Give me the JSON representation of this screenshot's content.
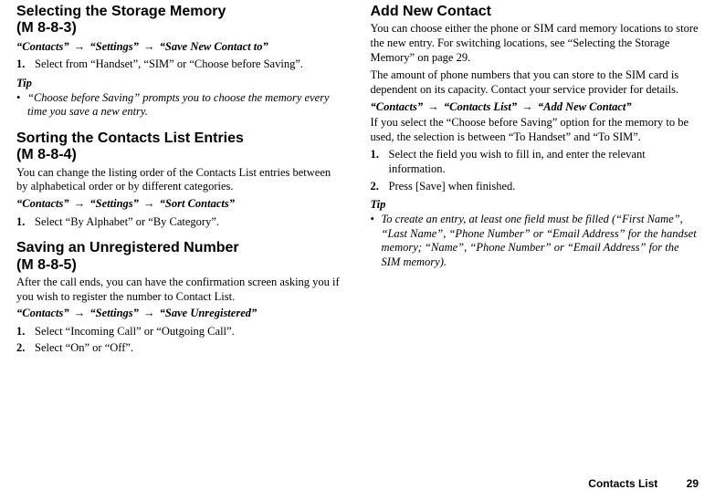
{
  "left": {
    "sec1": {
      "heading": "Selecting the Storage Memory",
      "mref": "(M 8-8-3)",
      "crumb1": "“Contacts”",
      "arrow": "→",
      "crumb2": "“Settings”",
      "crumb3": "“Save New Contact to”",
      "step1_num": "1.",
      "step1": "Select from “Handset”, “SIM” or “Choose before Saving”.",
      "tip_label": "Tip",
      "tip_bullet": "•",
      "tip_text": "“Choose before Saving” prompts you to choose the memory every time you save a new entry."
    },
    "sec2": {
      "heading": "Sorting the Contacts List Entries",
      "mref": "(M 8-8-4)",
      "body": "You can change the listing order of the Contacts List entries between by alphabetical order or by different categories.",
      "crumb1": "“Contacts”",
      "crumb2": "“Settings”",
      "crumb3": "“Sort Contacts”",
      "step1_num": "1.",
      "step1": "Select “By Alphabet” or “By Category”."
    },
    "sec3": {
      "heading": "Saving an Unregistered Number",
      "mref": "(M 8-8-5)",
      "body": "After the call ends, you can have the confirmation screen asking you if you wish to register the number to Contact List.",
      "crumb1": "“Contacts”",
      "crumb2": "“Settings”",
      "crumb3": "“Save Unregistered”",
      "step1_num": "1.",
      "step1": "Select “Incoming Call” or “Outgoing Call”.",
      "step2_num": "2.",
      "step2": "Select “On” or “Off”."
    }
  },
  "right": {
    "sec1": {
      "heading": "Add New Contact",
      "body1": "You can choose either the phone or SIM card memory locations to store the new entry. For switching locations, see “Selecting the Storage Memory” on page 29.",
      "body2": "The amount of phone numbers that you can store to the SIM card is dependent on its capacity. Contact your service provider for details.",
      "crumb1": "“Contacts”",
      "crumb2": "“Contacts List”",
      "crumb3": "“Add New Contact”",
      "body3": "If you select the “Choose before Saving” option for the memory to be used, the selection is between “To Handset” and “To SIM”.",
      "step1_num": "1.",
      "step1": "Select the field you wish to fill in, and enter the relevant information.",
      "step2_num": "2.",
      "step2": "Press [Save] when finished.",
      "tip_label": "Tip",
      "tip_bullet": "•",
      "tip_text": "To create an entry, at least one field must be filled (“First Name”, “Last Name”, “Phone Number” or “Email Address” for the handset memory; “Name”, “Phone Number” or “Email Address” for the SIM memory)."
    }
  },
  "footer": {
    "section": "Contacts List",
    "page": "29"
  }
}
